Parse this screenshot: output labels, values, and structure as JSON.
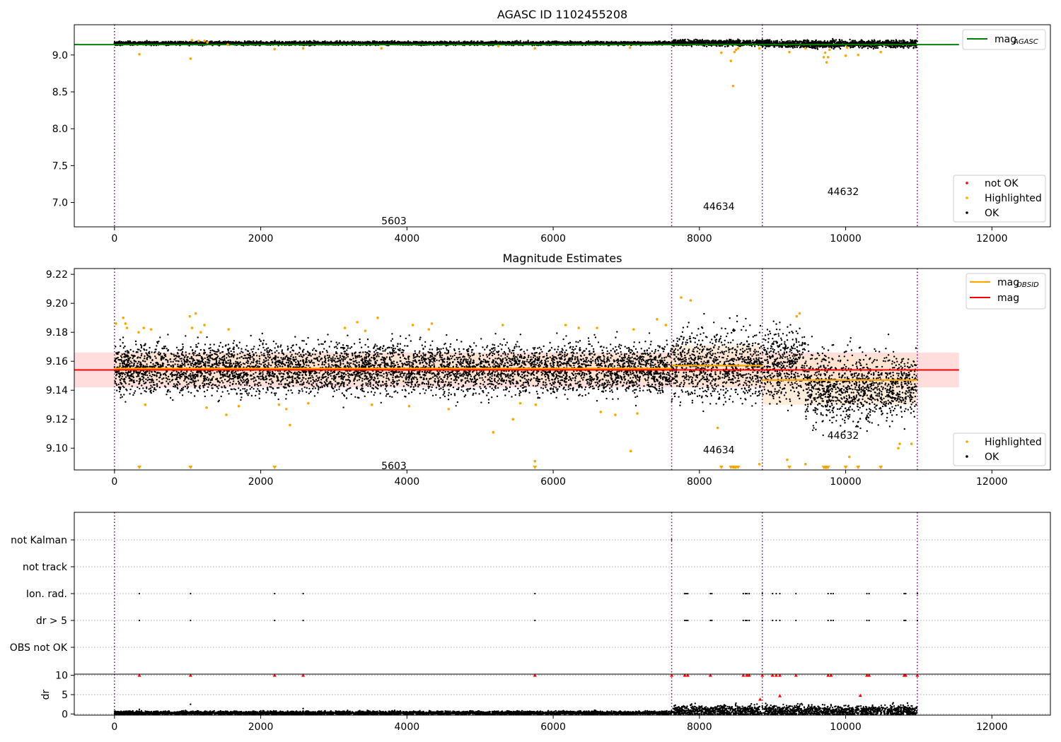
{
  "figure": {
    "title_top": "AGASC ID 1102455208",
    "title_mid": "Magnitude Estimates"
  },
  "colors": {
    "ok": "#000000",
    "highlighted": "#ffa500",
    "not_ok": "#ff0000",
    "agasc_line": "#008000",
    "obsid_line": "#ffa500",
    "mag_line": "#ff0000",
    "obs_boundary": "#800080",
    "band_mag": "#ffdddd",
    "band_obsid": "#ffe6cc"
  },
  "chart_data": [
    {
      "id": "agasc",
      "type": "scatter",
      "title": "AGASC ID 1102455208",
      "xlim": [
        -550,
        12800
      ],
      "ylim": [
        6.67,
        9.41
      ],
      "xticks": [
        0,
        2000,
        4000,
        6000,
        8000,
        10000,
        12000
      ],
      "yticks": [
        7.0,
        7.5,
        8.0,
        8.5,
        9.0
      ],
      "grid": false,
      "legend_position": "bottom-right",
      "legend_top_right": [
        {
          "label": "mag",
          "subscript": "AGASC",
          "color": "#008000",
          "marker": "line"
        }
      ],
      "legend": [
        {
          "label": "not OK",
          "color": "#ff0000",
          "marker": "dot"
        },
        {
          "label": "Highlighted",
          "color": "#ffa500",
          "marker": "dot"
        },
        {
          "label": "OK",
          "color": "#000000",
          "marker": "dot"
        }
      ],
      "hlines": [
        {
          "y": 9.14,
          "x": [
            -550,
            11550
          ],
          "color": "#008000",
          "label": "mag_AGASC"
        }
      ],
      "vlines": [
        0,
        7620,
        8860,
        10980
      ],
      "annotations": [
        {
          "text": "5603",
          "x": 3650,
          "y": 6.75
        },
        {
          "text": "44634",
          "x": 8050,
          "y": 6.95
        },
        {
          "text": "44632",
          "x": 9750,
          "y": 7.15
        }
      ],
      "ok_envelope": [
        {
          "x": [
            0,
            7620
          ],
          "center": 9.158,
          "spread": 0.012
        },
        {
          "x": [
            7620,
            8860
          ],
          "center": 9.165,
          "spread": 0.02
        },
        {
          "x": [
            8860,
            10980
          ],
          "center": 9.15,
          "spread": 0.025
        }
      ],
      "highlighted_points": [
        {
          "x": 340,
          "y": 9.01
        },
        {
          "x": 1040,
          "y": 8.95
        },
        {
          "x": 1060,
          "y": 9.2
        },
        {
          "x": 1150,
          "y": 9.19
        },
        {
          "x": 1230,
          "y": 9.19
        },
        {
          "x": 1270,
          "y": 9.17
        },
        {
          "x": 1550,
          "y": 9.14
        },
        {
          "x": 2190,
          "y": 9.08
        },
        {
          "x": 2580,
          "y": 9.09
        },
        {
          "x": 3650,
          "y": 9.09
        },
        {
          "x": 5250,
          "y": 9.12
        },
        {
          "x": 5750,
          "y": 9.09
        },
        {
          "x": 7050,
          "y": 9.1
        },
        {
          "x": 8300,
          "y": 9.03
        },
        {
          "x": 8430,
          "y": 8.92
        },
        {
          "x": 8460,
          "y": 8.58
        },
        {
          "x": 8480,
          "y": 9.04
        },
        {
          "x": 8500,
          "y": 9.07
        },
        {
          "x": 8530,
          "y": 9.09
        },
        {
          "x": 8820,
          "y": 9.09
        },
        {
          "x": 9230,
          "y": 9.04
        },
        {
          "x": 9450,
          "y": 9.09
        },
        {
          "x": 9700,
          "y": 8.97
        },
        {
          "x": 9720,
          "y": 9.03
        },
        {
          "x": 9740,
          "y": 8.9
        },
        {
          "x": 9760,
          "y": 8.97
        },
        {
          "x": 9780,
          "y": 9.07
        },
        {
          "x": 10000,
          "y": 8.99
        },
        {
          "x": 10020,
          "y": 9.1
        },
        {
          "x": 10170,
          "y": 9.0
        },
        {
          "x": 10480,
          "y": 9.04
        }
      ]
    },
    {
      "id": "estimates",
      "type": "scatter",
      "title": "Magnitude Estimates",
      "xlim": [
        -550,
        12800
      ],
      "ylim": [
        9.085,
        9.224
      ],
      "xticks": [
        0,
        2000,
        4000,
        6000,
        8000,
        10000,
        12000
      ],
      "yticks": [
        9.1,
        9.12,
        9.14,
        9.16,
        9.18,
        9.2,
        9.22
      ],
      "grid": false,
      "legend_position": "bottom-right",
      "legend_top_right": [
        {
          "label": "mag",
          "subscript": "OBSID",
          "color": "#ffa500",
          "marker": "line"
        },
        {
          "label": "mag",
          "subscript": "",
          "color": "#ff0000",
          "marker": "line"
        }
      ],
      "legend": [
        {
          "label": "Highlighted",
          "color": "#ffa500",
          "marker": "dot"
        },
        {
          "label": "OK",
          "color": "#000000",
          "marker": "dot"
        }
      ],
      "mag": {
        "value": 9.154,
        "band": [
          9.142,
          9.166
        ],
        "x": [
          -550,
          11550
        ]
      },
      "obsid_segments": [
        {
          "obsid": "5603",
          "x": [
            0,
            7620
          ],
          "mag": 9.155,
          "band": [
            9.145,
            9.165
          ]
        },
        {
          "obsid": "44634",
          "x": [
            7620,
            8860
          ],
          "mag": 9.157,
          "band": [
            9.143,
            9.171
          ]
        },
        {
          "obsid": "44632",
          "x": [
            8860,
            10980
          ],
          "mag": 9.147,
          "band": [
            9.13,
            9.164
          ]
        }
      ],
      "vlines": [
        0,
        7620,
        8860,
        10980
      ],
      "annotations": [
        {
          "text": "5603",
          "x": 3650,
          "y": 9.088
        },
        {
          "text": "44634",
          "x": 8050,
          "y": 9.099
        },
        {
          "text": "44632",
          "x": 9750,
          "y": 9.109
        }
      ],
      "highlighted_points": [
        {
          "x": 20,
          "y": 9.186
        },
        {
          "x": 120,
          "y": 9.19
        },
        {
          "x": 150,
          "y": 9.186
        },
        {
          "x": 170,
          "y": 9.183
        },
        {
          "x": 330,
          "y": 9.18
        },
        {
          "x": 400,
          "y": 9.183
        },
        {
          "x": 420,
          "y": 9.13
        },
        {
          "x": 500,
          "y": 9.182
        },
        {
          "x": 1030,
          "y": 9.191
        },
        {
          "x": 1060,
          "y": 9.183
        },
        {
          "x": 1110,
          "y": 9.193
        },
        {
          "x": 1180,
          "y": 9.18
        },
        {
          "x": 1230,
          "y": 9.185
        },
        {
          "x": 1260,
          "y": 9.128
        },
        {
          "x": 1530,
          "y": 9.123
        },
        {
          "x": 1560,
          "y": 9.182
        },
        {
          "x": 1700,
          "y": 9.129
        },
        {
          "x": 2250,
          "y": 9.13
        },
        {
          "x": 2350,
          "y": 9.127
        },
        {
          "x": 2400,
          "y": 9.116
        },
        {
          "x": 2650,
          "y": 9.131
        },
        {
          "x": 3150,
          "y": 9.183
        },
        {
          "x": 3320,
          "y": 9.187
        },
        {
          "x": 3430,
          "y": 9.181
        },
        {
          "x": 3520,
          "y": 9.13
        },
        {
          "x": 3600,
          "y": 9.19
        },
        {
          "x": 4030,
          "y": 9.129
        },
        {
          "x": 4080,
          "y": 9.185
        },
        {
          "x": 4300,
          "y": 9.182
        },
        {
          "x": 4340,
          "y": 9.186
        },
        {
          "x": 4570,
          "y": 9.127
        },
        {
          "x": 5180,
          "y": 9.111
        },
        {
          "x": 5310,
          "y": 9.185
        },
        {
          "x": 5450,
          "y": 9.12
        },
        {
          "x": 5550,
          "y": 9.131
        },
        {
          "x": 5750,
          "y": 9.091
        },
        {
          "x": 5760,
          "y": 9.13
        },
        {
          "x": 6170,
          "y": 9.185
        },
        {
          "x": 6350,
          "y": 9.183
        },
        {
          "x": 6600,
          "y": 9.183
        },
        {
          "x": 6650,
          "y": 9.125
        },
        {
          "x": 6850,
          "y": 9.123
        },
        {
          "x": 7060,
          "y": 9.098
        },
        {
          "x": 7100,
          "y": 9.182
        },
        {
          "x": 7150,
          "y": 9.124
        },
        {
          "x": 7420,
          "y": 9.189
        },
        {
          "x": 7540,
          "y": 9.185
        },
        {
          "x": 7750,
          "y": 9.204
        },
        {
          "x": 7880,
          "y": 9.202
        },
        {
          "x": 8250,
          "y": 9.114
        },
        {
          "x": 8820,
          "y": 9.089
        },
        {
          "x": 9200,
          "y": 9.092
        },
        {
          "x": 9330,
          "y": 9.191
        },
        {
          "x": 9370,
          "y": 9.193
        },
        {
          "x": 9450,
          "y": 9.089
        },
        {
          "x": 10050,
          "y": 9.094
        },
        {
          "x": 10720,
          "y": 9.1
        },
        {
          "x": 10740,
          "y": 9.103
        },
        {
          "x": 10900,
          "y": 9.103
        }
      ],
      "out_of_range_markers": [
        340,
        1040,
        2190,
        5750,
        8300,
        8430,
        8460,
        8480,
        8500,
        8530,
        9230,
        9700,
        9720,
        9740,
        9760,
        10000,
        10170,
        10480
      ]
    },
    {
      "id": "flags",
      "type": "scatter",
      "xlim": [
        -550,
        12800
      ],
      "ylim": [
        -0.5,
        5.5
      ],
      "xticks": [
        0,
        2000,
        4000,
        6000,
        8000,
        10000,
        12000
      ],
      "categories": [
        "not Kalman",
        "not track",
        "Ion. rad.",
        "dr > 5",
        "OBS not OK"
      ],
      "grid": "horizontal dotted",
      "vlines": [
        0,
        7620,
        8860,
        10980
      ],
      "flag_points": [
        {
          "flag": "not Kalman",
          "x": [
            7620
          ]
        },
        {
          "flag": "Ion. rad.",
          "x": [
            340,
            1040,
            2190,
            2580,
            5750,
            7800,
            7820,
            7840,
            8150,
            8170,
            8600,
            8630,
            8650,
            8680,
            8860,
            9000,
            9050,
            9100,
            9320,
            9760,
            9800,
            9830,
            10290,
            10320,
            10800,
            10820,
            10980
          ]
        },
        {
          "flag": "dr > 5",
          "x": [
            340,
            1040,
            2190,
            2580,
            5750,
            7800,
            7820,
            7840,
            8150,
            8170,
            8600,
            8630,
            8650,
            8680,
            8860,
            9000,
            9050,
            9100,
            9320,
            9760,
            9800,
            9830,
            10290,
            10320,
            10800,
            10820,
            10980
          ]
        }
      ]
    },
    {
      "id": "dr",
      "type": "scatter",
      "ylabel": "dr",
      "xlim": [
        -550,
        12800
      ],
      "ylim": [
        -0.3,
        10.3
      ],
      "xticks": [
        0,
        2000,
        4000,
        6000,
        8000,
        10000,
        12000
      ],
      "yticks": [
        0,
        5,
        10
      ],
      "grid": "horizontal dotted",
      "vlines": [
        0,
        7620,
        8860,
        10980
      ],
      "dr_envelope": [
        {
          "x": [
            0,
            7620
          ],
          "center": 0.25,
          "spread": 0.25
        },
        {
          "x": [
            7620,
            10980
          ],
          "center": 0.8,
          "spread": 0.7
        }
      ],
      "dr_outliers": [
        {
          "x": 340,
          "y": 1.2
        },
        {
          "x": 1040,
          "y": 2.5
        },
        {
          "x": 2580,
          "y": 1.4
        },
        {
          "x": 8500,
          "y": 2.8
        },
        {
          "x": 8860,
          "y": 2.1
        },
        {
          "x": 9800,
          "y": 2.4
        },
        {
          "x": 10000,
          "y": 2.2
        }
      ],
      "not_ok_points": [
        {
          "x": 340,
          "y": 10
        },
        {
          "x": 1040,
          "y": 10
        },
        {
          "x": 2190,
          "y": 10
        },
        {
          "x": 2580,
          "y": 10
        },
        {
          "x": 5750,
          "y": 10
        },
        {
          "x": 7620,
          "y": 10
        },
        {
          "x": 7800,
          "y": 10
        },
        {
          "x": 7840,
          "y": 10
        },
        {
          "x": 8150,
          "y": 10
        },
        {
          "x": 8600,
          "y": 10
        },
        {
          "x": 8650,
          "y": 10
        },
        {
          "x": 8680,
          "y": 10
        },
        {
          "x": 8860,
          "y": 10
        },
        {
          "x": 9000,
          "y": 10
        },
        {
          "x": 9050,
          "y": 10
        },
        {
          "x": 9100,
          "y": 10
        },
        {
          "x": 9320,
          "y": 10
        },
        {
          "x": 9760,
          "y": 10
        },
        {
          "x": 9800,
          "y": 10
        },
        {
          "x": 10290,
          "y": 10
        },
        {
          "x": 10320,
          "y": 10
        },
        {
          "x": 10800,
          "y": 10
        },
        {
          "x": 10820,
          "y": 10
        },
        {
          "x": 10980,
          "y": 10
        },
        {
          "x": 8830,
          "y": 3.8
        },
        {
          "x": 9100,
          "y": 4.7
        },
        {
          "x": 10200,
          "y": 4.8
        }
      ]
    }
  ]
}
